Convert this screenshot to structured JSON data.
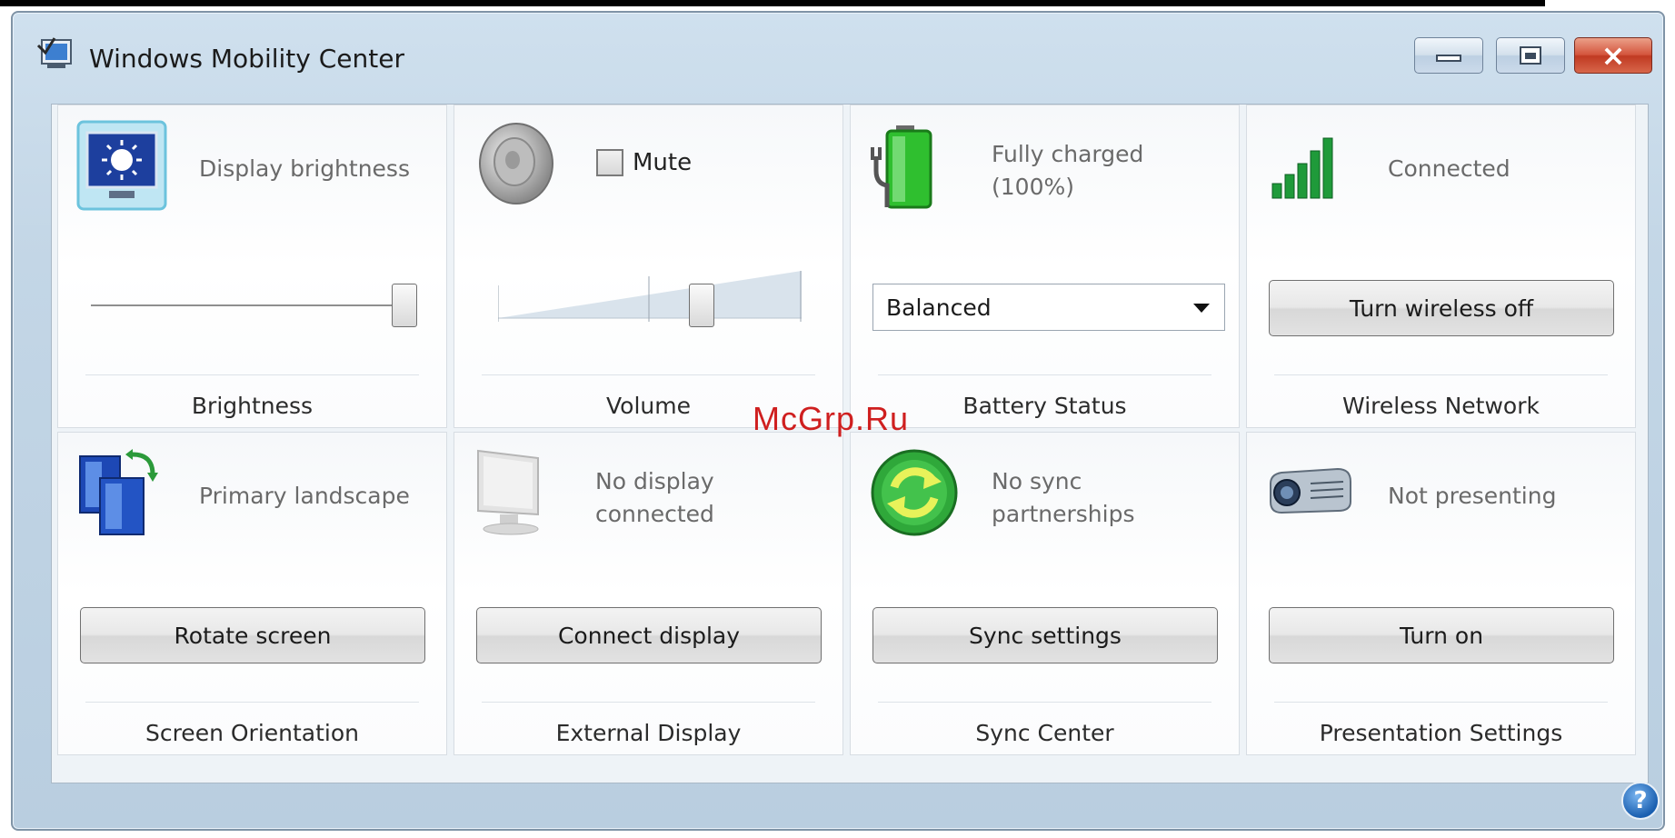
{
  "window": {
    "title": "Windows Mobility Center",
    "icon": "mobility-center-icon",
    "controls": {
      "minimize": "minimize-icon",
      "maximize": "maximize-icon",
      "close": "×"
    }
  },
  "tiles": {
    "brightness": {
      "status": "Display brightness",
      "caption": "Brightness",
      "level": 0.97,
      "icon": "display-brightness-icon"
    },
    "volume": {
      "mute_label": "Mute",
      "muted": false,
      "caption": "Volume",
      "level": 0.67,
      "icon": "speaker-icon"
    },
    "battery": {
      "status_line1": "Fully charged",
      "status_line2": "(100%)",
      "plan": "Balanced",
      "caption": "Battery Status",
      "icon": "battery-plug-icon"
    },
    "wireless": {
      "status": "Connected",
      "button": "Turn wireless off",
      "caption": "Wireless Network",
      "icon": "signal-strength-icon"
    },
    "orientation": {
      "status": "Primary landscape",
      "button": "Rotate screen",
      "caption": "Screen Orientation",
      "icon": "rotate-screen-icon"
    },
    "display": {
      "status_line1": "No display",
      "status_line2": "connected",
      "button": "Connect display",
      "caption": "External Display",
      "icon": "monitor-icon"
    },
    "sync": {
      "status_line1": "No sync",
      "status_line2": "partnerships",
      "button": "Sync settings",
      "caption": "Sync Center",
      "icon": "sync-icon"
    },
    "presentation": {
      "status": "Not presenting",
      "button": "Turn on",
      "caption": "Presentation Settings",
      "icon": "projector-icon"
    }
  },
  "watermark": "McGrp.Ru",
  "help": {
    "label": "?",
    "icon": "help-icon"
  },
  "colors": {
    "battery_green": "#2fbf2f",
    "signal_green": "#1f9a3a",
    "accent_blue": "#2b6cc4"
  }
}
